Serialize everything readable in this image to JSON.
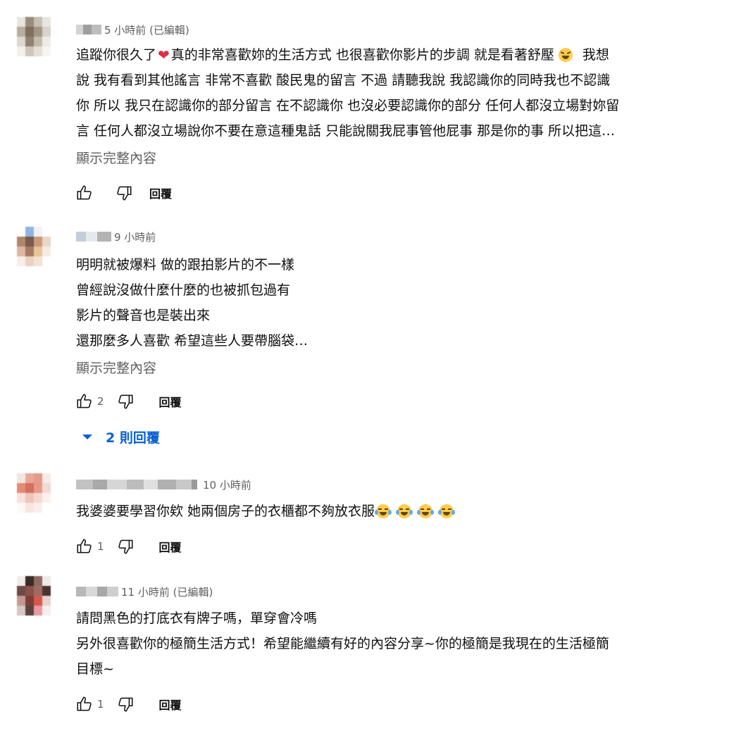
{
  "comments": [
    {
      "time": "5 小時前 (已編輯)",
      "lines": [
        [
          "追蹤你很久了",
          "真的非常喜歡妳的生活方式 也很喜歡你影片的步調 就是看著舒壓",
          "我想"
        ],
        "說 我有看到其他謠言 非常不喜歡 酸民鬼的留言 不過 請聽我說 我認識你的同時我也不認識",
        "你 所以 我只在認識你的部分留言 在不認識你 也沒必要認識你的部分 任何人都沒立場對妳留",
        "言 任何人都沒立場說你不要在意這種鬼話 只能說關我屁事管他屁事 那是你的事 所以把這…"
      ],
      "show_more": "顯示完整內容",
      "like_count": "",
      "reply": "回覆"
    },
    {
      "time": "9 小時前",
      "lines": [
        "明明就被爆料 做的跟拍影片的不一樣",
        "曾經說沒做什麼什麼的也被抓包過有",
        "影片的聲音也是裝出來",
        "還那麼多人喜歡 希望這些人要帶腦袋…"
      ],
      "show_more": "顯示完整內容",
      "like_count": "2",
      "reply": "回覆",
      "replies_label": "2 則回覆"
    },
    {
      "time": "10 小時前",
      "lines": [
        "我婆婆要學習你欸 她兩個房子的衣櫃都不夠放衣服"
      ],
      "like_count": "1",
      "reply": "回覆"
    },
    {
      "time": "11 小時前 (已編輯)",
      "lines": [
        "請問黑色的打底衣有牌子嗎，單穿會冷嗎",
        "另外很喜歡你的極簡生活方式！希望能繼續有好的內容分享~你的極簡是我現在的生活極簡",
        "目標~"
      ],
      "like_count": "1",
      "reply": "回覆"
    }
  ],
  "icons": {
    "like": "thumbs-up-icon",
    "dislike": "thumbs-down-icon",
    "expand": "caret-down-icon",
    "heart": "red-heart-emoji",
    "laugh": "tears-of-joy-emoji",
    "grin": "grinning-squinting-emoji"
  },
  "colors": {
    "link_blue": "#065fd4",
    "secondary_text": "#606060",
    "primary_text": "#0f0f0f"
  }
}
